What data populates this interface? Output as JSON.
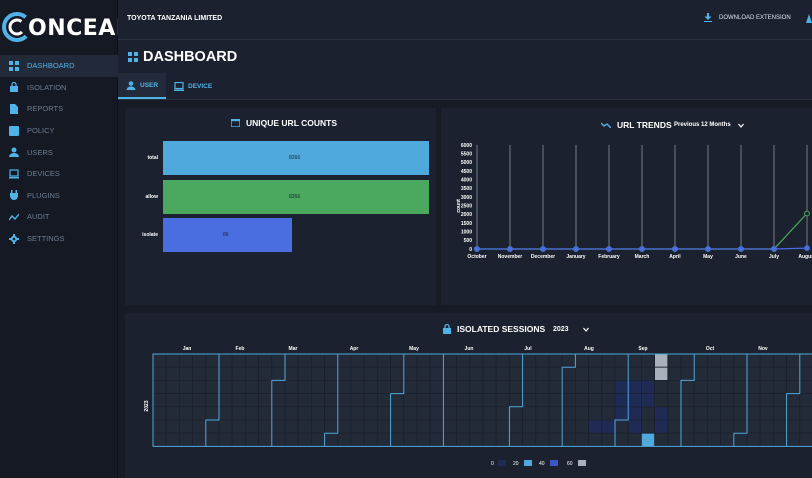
{
  "app": {
    "logo_text": "ONCEAL"
  },
  "sidebar": {
    "items": [
      {
        "label": "DASHBOARD",
        "icon": "dashboard-icon"
      },
      {
        "label": "ISOLATION",
        "icon": "lock-icon"
      },
      {
        "label": "REPORTS",
        "icon": "reports-icon"
      },
      {
        "label": "POLICY",
        "icon": "policy-icon"
      },
      {
        "label": "USERS",
        "icon": "user-icon"
      },
      {
        "label": "DEVICES",
        "icon": "laptop-icon"
      },
      {
        "label": "PLUGINS",
        "icon": "plug-icon"
      },
      {
        "label": "AUDIT",
        "icon": "audit-icon"
      },
      {
        "label": "SETTINGS",
        "icon": "gear-icon"
      }
    ]
  },
  "topbar": {
    "company": "TOYOTA TANZANIA LIMITED",
    "download_label": "DOWNLOAD EXTENSION"
  },
  "page": {
    "title": "DASHBOARD",
    "tabs": [
      {
        "label": "USER"
      },
      {
        "label": "DEVICE"
      }
    ]
  },
  "unique_urls": {
    "title": "UNIQUE URL COUNTS",
    "rows": [
      {
        "label": "total",
        "value": "8266",
        "color": "#4fa9dc"
      },
      {
        "label": "allow",
        "value": "8266",
        "color": "#4aa85f"
      },
      {
        "label": "isolate",
        "value": "86",
        "color": "#4a6ee0"
      }
    ]
  },
  "url_trends": {
    "title": "URL TRENDS",
    "range": "Previous 12 Months",
    "ylabel": "count",
    "yticks": [
      "6000",
      "5500",
      "5000",
      "4500",
      "4000",
      "3500",
      "3000",
      "2500",
      "2000",
      "1500",
      "1000",
      "500",
      "0"
    ],
    "months": [
      "October",
      "November",
      "December",
      "January",
      "February",
      "March",
      "April",
      "May",
      "June",
      "July",
      "August"
    ]
  },
  "chart_data": {
    "type": "line",
    "ylabel": "count",
    "ylim": [
      0,
      6000
    ],
    "x": [
      "October",
      "November",
      "December",
      "January",
      "February",
      "March",
      "April",
      "May",
      "June",
      "July",
      "August"
    ],
    "series": [
      {
        "values": [
          0,
          0,
          0,
          0,
          0,
          0,
          0,
          0,
          0,
          0,
          2050
        ],
        "color": "#4aa85f"
      },
      {
        "values": [
          0,
          0,
          0,
          0,
          0,
          0,
          0,
          0,
          0,
          0,
          50
        ],
        "color": "#4a6ee0"
      }
    ]
  },
  "sessions": {
    "title": "ISOLATED SESSIONS",
    "year": "2023",
    "months": [
      "Jan",
      "Feb",
      "Mar",
      "Apr",
      "May",
      "Jun",
      "Jul",
      "Aug",
      "Sep",
      "Oct",
      "Nov"
    ],
    "legend": [
      {
        "label": "0",
        "color": "#1f2a55"
      },
      {
        "label": "20",
        "color": "#4fa9dc"
      },
      {
        "label": "40",
        "color": "#3a57c9"
      },
      {
        "label": "60",
        "color": "#a9b1bd"
      }
    ]
  }
}
